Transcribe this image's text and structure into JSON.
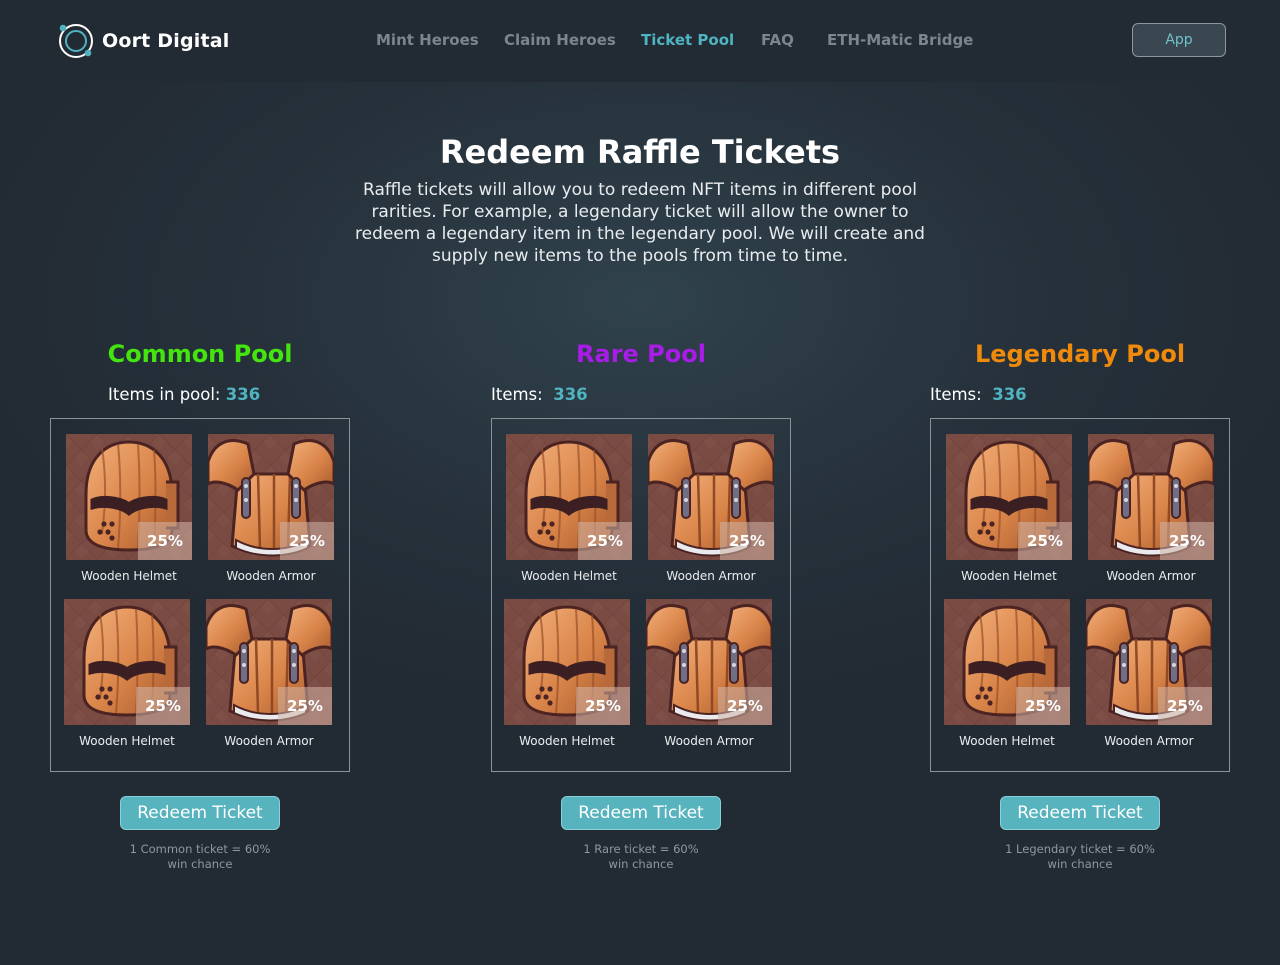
{
  "brand": {
    "name": "Oort Digital"
  },
  "nav": {
    "items": [
      {
        "label": "Mint Heroes",
        "active": false
      },
      {
        "label": "Claim Heroes",
        "active": false
      },
      {
        "label": "Ticket Pool",
        "active": true
      },
      {
        "label": "FAQ",
        "active": false
      },
      {
        "label": "ETH-Matic Bridge",
        "active": false
      }
    ],
    "app_button": "App"
  },
  "hero": {
    "title": "Redeem Raffle Tickets",
    "description": "Raffle tickets  will allow you to redeem NFT items in different pool rarities. For example, a legendary ticket will allow the owner to redeem a legendary item in the legendary pool. We will create and supply new items to the pools from time to time."
  },
  "colors": {
    "accent": "#4fb3c0",
    "common": "#44e40f",
    "rare": "#a71ce6",
    "legendary": "#f08a0b",
    "background": "#26313b"
  },
  "pools": [
    {
      "title": "Common Pool",
      "count_label": "Items in pool: ",
      "count_value": "336",
      "items": [
        {
          "name": "Wooden Helmet",
          "percent": "25%",
          "icon": "wooden-helmet-icon"
        },
        {
          "name": "Wooden Armor",
          "percent": "25%",
          "icon": "wooden-armor-icon"
        },
        {
          "name": "Wooden Helmet",
          "percent": "25%",
          "icon": "wooden-helmet-icon"
        },
        {
          "name": "Wooden Armor",
          "percent": "25%",
          "icon": "wooden-armor-icon"
        }
      ],
      "button": "Redeem Ticket",
      "chance_line1": "1 Common ticket = 60%",
      "chance_line2": "win chance"
    },
    {
      "title": "Rare Pool",
      "count_label": "Items:  ",
      "count_value": "336",
      "items": [
        {
          "name": "Wooden Helmet",
          "percent": "25%",
          "icon": "wooden-helmet-icon"
        },
        {
          "name": "Wooden Armor",
          "percent": "25%",
          "icon": "wooden-armor-icon"
        },
        {
          "name": "Wooden Helmet",
          "percent": "25%",
          "icon": "wooden-helmet-icon"
        },
        {
          "name": "Wooden Armor",
          "percent": "25%",
          "icon": "wooden-armor-icon"
        }
      ],
      "button": "Redeem Ticket",
      "chance_line1": "1 Rare ticket = 60%",
      "chance_line2": "win chance"
    },
    {
      "title": "Legendary Pool",
      "count_label": "Items:  ",
      "count_value": "336",
      "items": [
        {
          "name": "Wooden Helmet",
          "percent": "25%",
          "icon": "wooden-helmet-icon"
        },
        {
          "name": "Wooden Armor",
          "percent": "25%",
          "icon": "wooden-armor-icon"
        },
        {
          "name": "Wooden Helmet",
          "percent": "25%",
          "icon": "wooden-helmet-icon"
        },
        {
          "name": "Wooden Armor",
          "percent": "25%",
          "icon": "wooden-armor-icon"
        }
      ],
      "button": "Redeem Ticket",
      "chance_line1": "1 Legendary ticket = 60%",
      "chance_line2": "win chance"
    }
  ]
}
